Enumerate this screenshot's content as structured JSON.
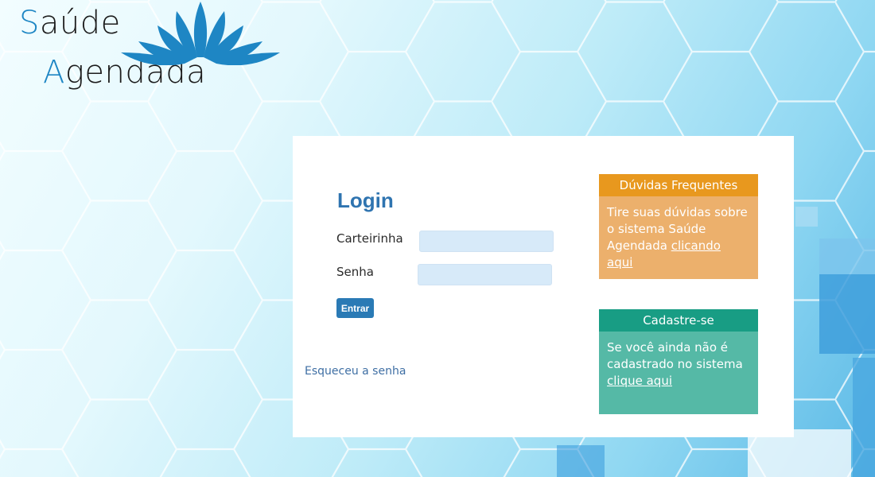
{
  "logo": {
    "line1_initial": "S",
    "line1_rest": "aúde",
    "line2_initial": "A",
    "line2_rest": "gendada",
    "accent_color": "#1e86c4"
  },
  "login": {
    "title": "Login",
    "carteirinha_label": "Carteirinha",
    "carteirinha_value": "",
    "senha_label": "Senha",
    "senha_value": "",
    "submit_label": "Entrar",
    "forgot_label": "Esqueceu a senha"
  },
  "faq": {
    "header": "Dúvidas Frequentes",
    "text": "Tire suas dúvidas sobre o sistema Saúde Agendada ",
    "link_label": "clicando aqui",
    "header_color": "#e8981e",
    "body_color": "#ecb06c"
  },
  "signup": {
    "header": "Cadastre-se",
    "text": "Se você ainda não é cadastrado no sistema ",
    "link_label": "clique aqui",
    "header_color": "#189d84",
    "body_color": "#55b9a6"
  },
  "colors": {
    "primary": "#2a7ab5",
    "title": "#2f74b0",
    "input_bg": "#d7eaf9"
  }
}
